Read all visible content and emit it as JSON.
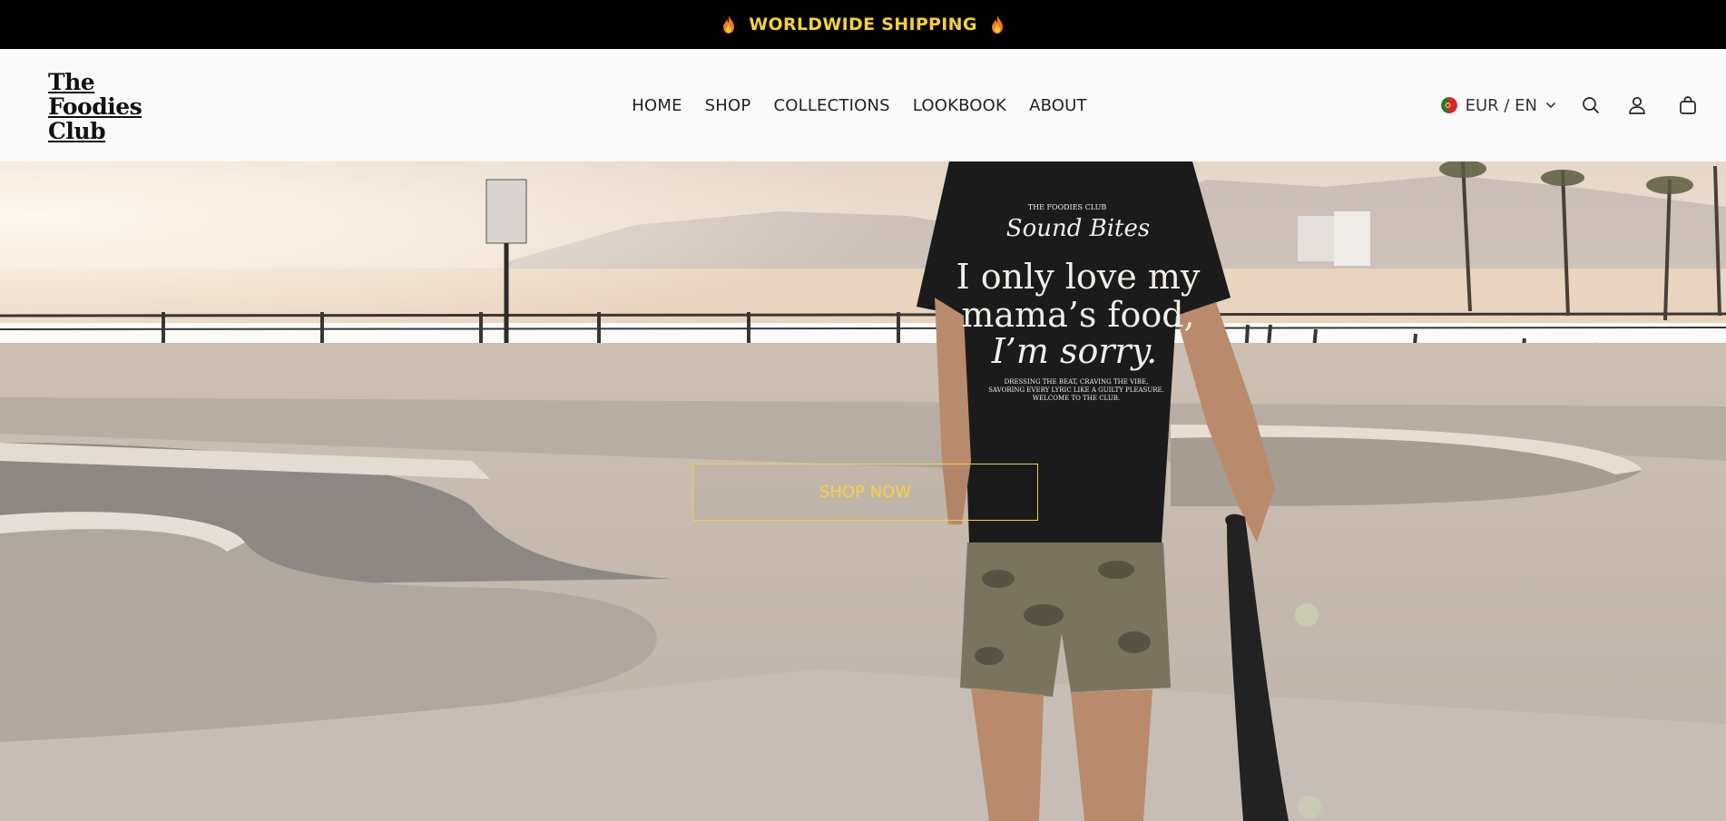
{
  "announcement": {
    "text": "WORLDWIDE SHIPPING",
    "icon_left": "fire-icon",
    "icon_right": "fire-icon",
    "text_color": "#f5cf3c",
    "background": "#000000"
  },
  "logo": {
    "lines": [
      "The",
      "Foodies",
      "Club"
    ]
  },
  "nav": {
    "items": [
      {
        "label": "HOME"
      },
      {
        "label": "SHOP"
      },
      {
        "label": "COLLECTIONS"
      },
      {
        "label": "LOOKBOOK"
      },
      {
        "label": "ABOUT"
      }
    ]
  },
  "header_tools": {
    "locale": "EUR / EN",
    "flag_icon": "portugal-flag-icon",
    "search_icon": "search-icon",
    "account_icon": "user-icon",
    "cart_icon": "shopping-bag-icon"
  },
  "hero": {
    "cta_label": "SHOP NOW",
    "cta_color": "#f4d23f",
    "shirt": {
      "brand": "THE FOODIES CLUB",
      "script": "Sound Bites",
      "line1": "I only love my",
      "line2": "mama’s food,",
      "line3": "I’m sorry.",
      "small1": "DRESSING THE BEAT, CRAVING THE VIBE,",
      "small2": "SAVORING EVERY LYRIC LIKE A GUILTY PLEASURE.",
      "small3": "WELCOME TO THE CLUB."
    }
  }
}
